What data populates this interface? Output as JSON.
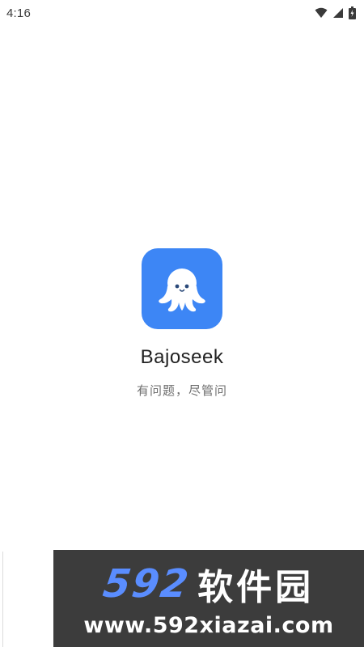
{
  "status_bar": {
    "time": "4:16",
    "icons": [
      "wifi-icon",
      "cellular-signal-icon",
      "battery-charging-icon"
    ]
  },
  "splash": {
    "app_icon": "octopus-logo-icon",
    "app_name": "Bajoseek",
    "slogan": "有问题，尽管问"
  },
  "watermark": {
    "number": "592",
    "brand_cn": "软件园",
    "url": "www.592xiazai.com"
  },
  "colors": {
    "accent": "#3d86f5",
    "background": "#ffffff",
    "watermark_bg": "#3c3c3c",
    "watermark_number": "#5a8dff"
  }
}
